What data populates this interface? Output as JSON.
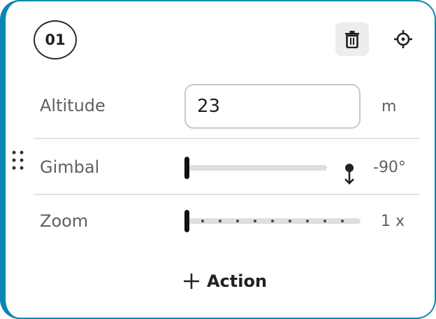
{
  "waypoint": {
    "number": "01"
  },
  "icons": {
    "delete": "trash-icon",
    "locate": "crosshair-icon",
    "drag": "drag-handle-icon",
    "gimbal": "gimbal-down-icon",
    "add": "plus-icon"
  },
  "colors": {
    "accent": "#0a87b2",
    "text": "#222222",
    "muted": "#606060",
    "track": "#dedede",
    "thumb": "#111111"
  },
  "altitude": {
    "label": "Altitude",
    "value": "23",
    "unit": "m"
  },
  "gimbal": {
    "label": "Gimbal",
    "value": "-90°",
    "level": 0
  },
  "zoom": {
    "label": "Zoom",
    "value": "1 x",
    "level": 0
  },
  "actions": {
    "add_label": "Action"
  }
}
